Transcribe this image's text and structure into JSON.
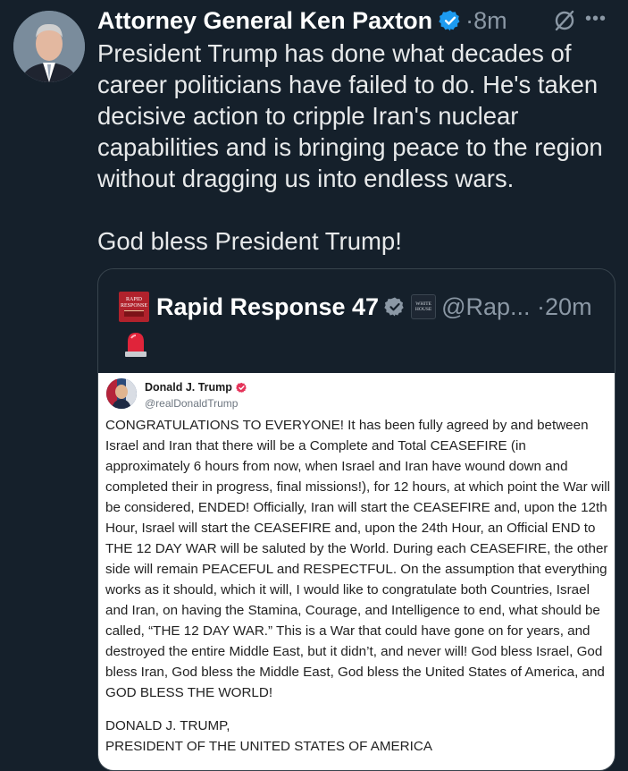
{
  "tweet": {
    "author_name": "Attorney General Ken Paxton",
    "time": "8m",
    "text_paragraphs": [
      "President Trump has done what decades of career politicians have failed to do. He's taken decisive action to cripple Iran's nuclear capabilities and is bringing peace to the region without dragging us into endless wars.",
      "God bless President Trump!"
    ]
  },
  "quote": {
    "name": "Rapid Response 47",
    "handle": "@Rap...",
    "time": "20m",
    "logo_text": [
      "RAPID",
      "RESPONSE"
    ],
    "badge_text": [
      "WHITE",
      "HOUSE"
    ]
  },
  "truth_post": {
    "name": "Donald J. Trump",
    "handle": "@realDonaldTrump",
    "body": "CONGRATULATIONS TO EVERYONE! It has been fully agreed by and between Israel and Iran that there will be a Complete and Total CEASEFIRE (in approximately 6 hours from now, when Israel and Iran have wound down and completed their in progress, final missions!), for 12 hours, at which point the War will be considered, ENDED! Officially, Iran will start the CEASEFIRE and, upon the 12th Hour, Israel will start the CEASEFIRE and, upon the 24th Hour, an Official END to THE 12 DAY WAR will be saluted by the World. During each CEASEFIRE, the other side will remain PEACEFUL and RESPECTFUL. On the assumption that everything works as it should, which it will, I would like to congratulate both Countries, Israel and Iran, on having the Stamina, Courage, and Intelligence to end, what should be called, “THE 12 DAY WAR.” This is a War that could have gone on for years, and destroyed the entire Middle East, but it didn’t, and never will! God bless Israel, God bless Iran, God bless the Middle East, God bless the United States of America, and GOD BLESS THE WORLD!",
    "signature_name": "DONALD J. TRUMP,",
    "signature_title": "PRESIDENT OF THE UNITED STATES OF AMERICA"
  },
  "icons": {
    "verified": "verified-badge-icon",
    "grok": "grok-icon",
    "more": "more-icon",
    "siren": "siren-emoji-icon"
  },
  "colors": {
    "background": "#15202b",
    "text": "#e7e9ea",
    "secondary_text": "#8b98a5",
    "verified_blue": "#1d9bf0",
    "truth_verified": "#e5345a",
    "border": "#38444d"
  }
}
